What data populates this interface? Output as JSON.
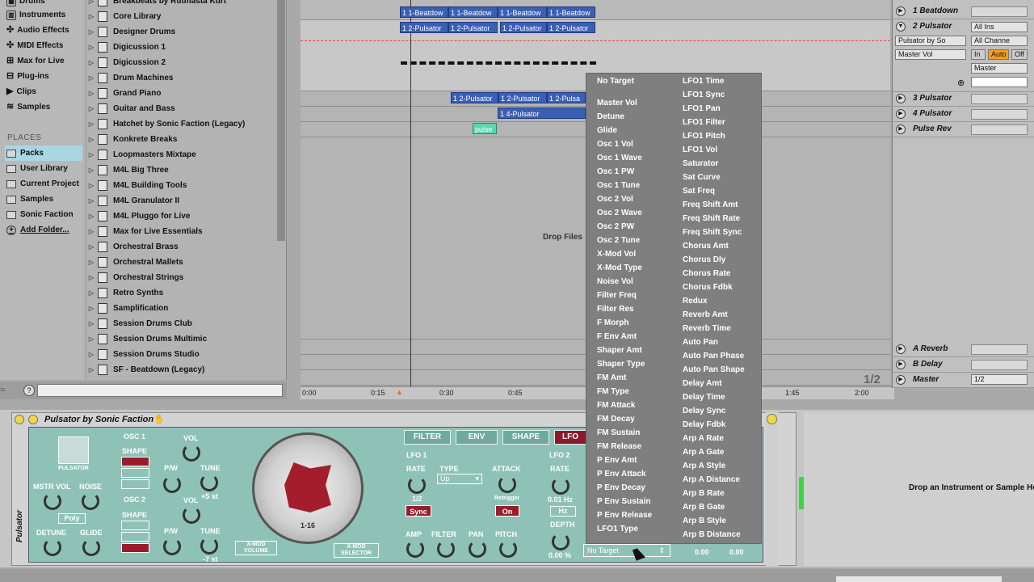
{
  "browser": {
    "categories": [
      {
        "label": "Drums",
        "icon": "folder-icon"
      },
      {
        "label": "Instruments",
        "icon": "keys-icon"
      },
      {
        "label": "Audio Effects",
        "icon": "fx-icon"
      },
      {
        "label": "MIDI Effects",
        "icon": "fx-icon"
      },
      {
        "label": "Max for Live",
        "icon": "max-icon"
      },
      {
        "label": "Plug-ins",
        "icon": "plugin-icon"
      },
      {
        "label": "Clips",
        "icon": "clip-icon"
      },
      {
        "label": "Samples",
        "icon": "wave-icon"
      }
    ],
    "places_header": "PLACES",
    "places": [
      "Packs",
      "User Library",
      "Current Project",
      "Samples",
      "Sonic Faction",
      "Add Folder..."
    ],
    "packs": [
      "Breakbeats by Rutmasta Kurt",
      "Core Library",
      "Designer Drums",
      "Digicussion 1",
      "Digicussion 2",
      "Drum Machines",
      "Grand Piano",
      "Guitar and Bass",
      "Hatchet by Sonic Faction (Legacy)",
      "Konkrete Breaks",
      "Loopmasters Mixtape",
      "M4L Big Three",
      "M4L Building Tools",
      "M4L Granulator II",
      "M4L Pluggo for Live",
      "Max for Live Essentials",
      "Orchestral Brass",
      "Orchestral Mallets",
      "Orchestral Strings",
      "Retro Synths",
      "Samplification",
      "Session Drums Club",
      "Session Drums Multimic",
      "Session Drums Studio",
      "SF - Beatdown (Legacy)"
    ]
  },
  "arrangement": {
    "clips_row1": [
      "1 1-Beatdow",
      "1 1-Beatdow",
      "1 1-Beatdow",
      "1 1-Beatdow"
    ],
    "clips_row2": [
      "1 2-Pulsator",
      "1 2-Pulsator",
      "1 2-Pulsator",
      "1 2-Pulsator"
    ],
    "clips_row3": [
      "1 2-Pulsator",
      "1 2-Pulsator",
      "1 2-Pulsa"
    ],
    "clip_row4": "1 4-Pulsator",
    "clip_pulse": "pulse",
    "drop_text": "Drop Files",
    "loop_fraction": "1/2",
    "timeline": [
      "0:00",
      "0:15",
      "0:30",
      "0:45",
      "1:45",
      "2:00"
    ]
  },
  "tracks": [
    {
      "name": "1 Beatdown"
    },
    {
      "name": "2 Pulsator"
    },
    {
      "name": "3 Pulsator"
    },
    {
      "name": "4 Pulsator"
    },
    {
      "name": "Pulse Rev"
    },
    {
      "name": "A Reverb"
    },
    {
      "name": "B Delay"
    },
    {
      "name": "Master"
    }
  ],
  "track2_io": {
    "input": "All Ins",
    "device": "Pulsator by So",
    "channel": "All Channe",
    "param": "Master Vol",
    "in": "In",
    "auto": "Auto",
    "off": "Off",
    "output": "Master"
  },
  "master_io": {
    "value": "1/2"
  },
  "device": {
    "title": "Pulsator by Sonic Faction",
    "logo": "PULSATOR",
    "osc1": "OSC 1",
    "osc2": "OSC 2",
    "shape": "SHAPE",
    "vol": "VOL",
    "pw": "P/W",
    "tune": "TUNE",
    "tune1_val": "+5 st",
    "tune2_val": "-7 st",
    "mstr_vol": "MSTR VOL",
    "noise": "NOISE",
    "poly": "Poly",
    "detune": "DETUNE",
    "glide": "GLIDE",
    "xmod_volume": "X-MOD VOLUME",
    "xmod_selector": "X-MOD SELECTOR",
    "dial_range": "1-16",
    "tabs": [
      "FILTER",
      "ENV",
      "SHAPE",
      "LFO"
    ],
    "lfo1": "LFO 1",
    "rate": "RATE",
    "type": "TYPE",
    "type_val": "Up",
    "attack": "ATTACK",
    "rate_val": "1/2",
    "sync": "Sync",
    "retrigger": "Retrigger",
    "on": "On",
    "amp": "AMP",
    "filter": "FILTER",
    "pan": "PAN",
    "pitch": "PITCH",
    "lfo2": "LFO 2",
    "rate2": "RATE",
    "rate2_val": "0.01 Hz",
    "hz": "Hz",
    "depth": "DEPTH",
    "depth_val": "0.00 %",
    "target": "No Target",
    "val_a": "0.00",
    "val_b": "0.00",
    "side_label": "Pulsator"
  },
  "menu": {
    "col1": [
      "No Target",
      "Master Vol",
      "Detune",
      "Glide",
      "Osc 1 Vol",
      "Osc 1 Wave",
      "Osc 1 PW",
      "Osc 1 Tune",
      "Osc 2 Vol",
      "Osc 2 Wave",
      "Osc 2 PW",
      "Osc 2 Tune",
      "X-Mod Vol",
      "X-Mod Type",
      "Noise Vol",
      "Filter Freq",
      "Filter Res",
      "F Morph",
      "F Env Amt",
      "Shaper Amt",
      "Shaper Type",
      "FM Amt",
      "FM Type",
      "FM Attack",
      "FM Decay",
      "FM Sustain",
      "FM Release",
      "P Env Amt",
      "P Env Attack",
      "P Env Decay",
      "P Env Sustain",
      "P Env Release",
      "LFO1 Type"
    ],
    "col2": [
      "LFO1 Time",
      "LFO1 Sync",
      "LFO1 Pan",
      "LFO1 Filter",
      "LFO1 Pitch",
      "LFO1 Vol",
      "Saturator",
      "Sat Curve",
      "Sat Freq",
      "Freq Shift Amt",
      "Freq Shift Rate",
      "Freq Shift Sync",
      "Chorus Amt",
      "Chorus Dly",
      "Chorus Rate",
      "Chorus Fdbk",
      "Redux",
      "Reverb Amt",
      "Reverb Time",
      "Auto Pan",
      "Auto Pan Phase",
      "Auto Pan Shape",
      "Delay Amt",
      "Delay Time",
      "Delay Sync",
      "Delay Fdbk",
      "Arp A Rate",
      "Arp A Gate",
      "Arp A Style",
      "Arp A Distance",
      "Arp B Rate",
      "Arp B Gate",
      "Arp B Style",
      "Arp B Distance"
    ]
  },
  "instrument_drop": "Drop an Instrument or Sample Here",
  "colors": {
    "clip": "#3b5fb5",
    "plugin_bg": "#8ec2b7",
    "accent_red": "#9a1c2a",
    "sync_green": "#5ad5b0"
  }
}
